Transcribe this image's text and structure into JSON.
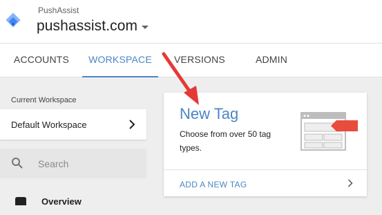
{
  "header": {
    "account_name": "PushAssist",
    "container_name": "pushassist.com",
    "logo_icon": "google-tag-manager-logo-icon",
    "dropdown_icon": "caret-down-icon"
  },
  "tabs": [
    {
      "label": "ACCOUNTS",
      "active": false
    },
    {
      "label": "WORKSPACE",
      "active": true
    },
    {
      "label": "VERSIONS",
      "active": false
    },
    {
      "label": "ADMIN",
      "active": false
    }
  ],
  "sidebar": {
    "current_workspace_label": "Current Workspace",
    "workspace_name": "Default Workspace",
    "search_placeholder": "Search",
    "nav": [
      {
        "label": "Overview",
        "icon": "folder-icon"
      }
    ]
  },
  "card": {
    "title": "New Tag",
    "description": "Choose from over 50 tag types.",
    "action_label": "ADD A NEW TAG",
    "illustration": "tag-template-icon"
  },
  "annotation": {
    "type": "red-arrow-pointing-at-new-tag",
    "color": "#e53935"
  },
  "colors": {
    "accent": "#4a86c5",
    "tag_red": "#e84c3d",
    "background": "#eeeeee"
  }
}
